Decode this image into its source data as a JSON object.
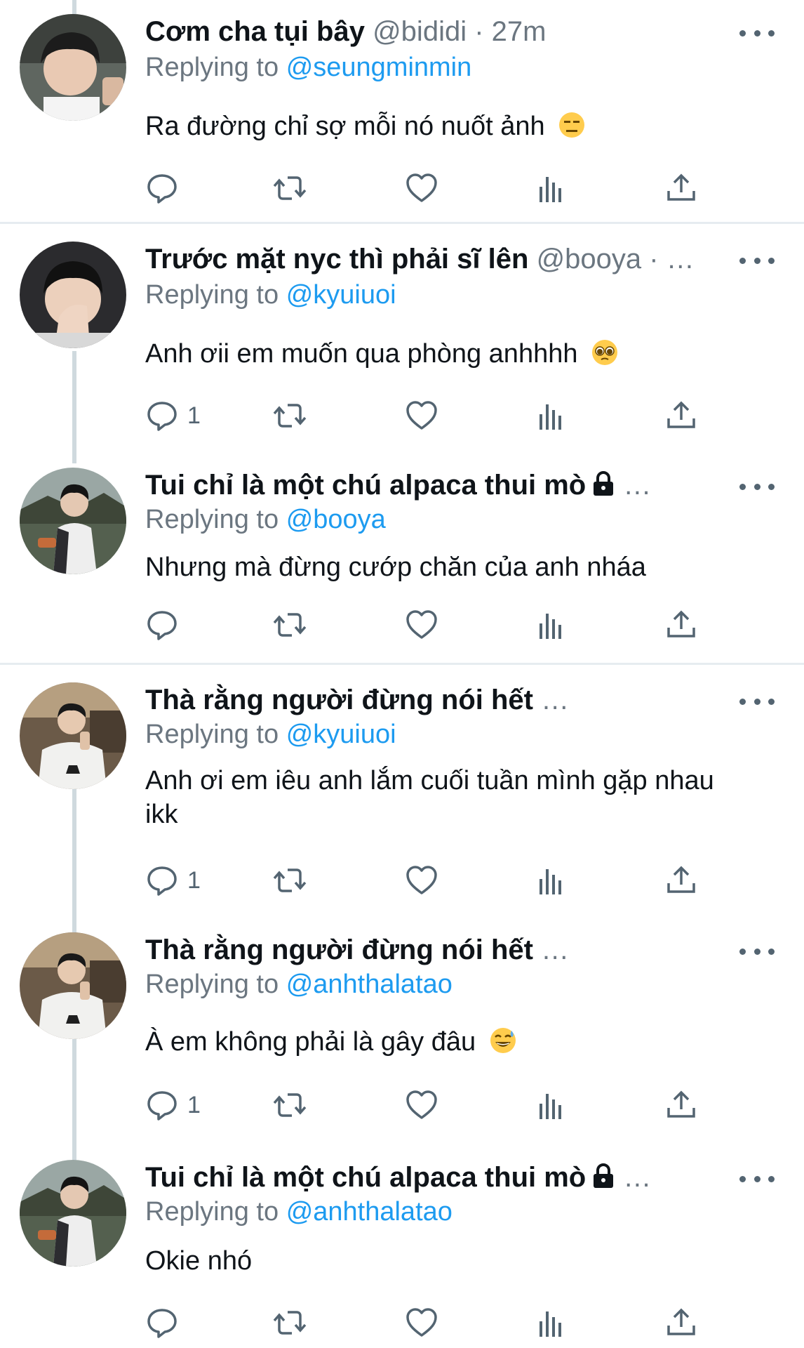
{
  "tweets": [
    {
      "name": "Cơm cha tụi bây",
      "handle": "@bididi",
      "time_sep": " · ",
      "time": "27m",
      "truncated": "",
      "locked": false,
      "reply_label": "Replying to",
      "reply_to": "@seungminmin",
      "text": "Ra đường chỉ sợ mỗi nó nuốt ảnh",
      "emoji": "expressionless-face",
      "reply_count": "",
      "avatar": "avatar-boy-glasses"
    },
    {
      "name": "Trước mặt nyc thì phải sĩ lên",
      "handle": "@booya",
      "time_sep": " · ",
      "time": "",
      "truncated": "…",
      "locked": false,
      "reply_label": "Replying to",
      "reply_to": "@kyuiuoi",
      "text": "Anh ơii em muốn qua phòng anhhhh",
      "emoji": "pleading-face",
      "reply_count": "1",
      "avatar": "avatar-boy-kiss"
    },
    {
      "name": "Tui chỉ là một chú alpaca thui mò",
      "handle": "",
      "time_sep": "",
      "time": "",
      "truncated": "…",
      "locked": true,
      "reply_label": "Replying to",
      "reply_to": "@booya",
      "text": "Nhưng mà đừng cướp chăn của anh nháa",
      "emoji": "",
      "reply_count": "",
      "avatar": "avatar-man-outdoor"
    },
    {
      "name": "Thà rằng người đừng nói hết",
      "handle": "",
      "time_sep": "",
      "time": "",
      "truncated": "…",
      "locked": false,
      "reply_label": "Replying to",
      "reply_to": "@kyuiuoi",
      "text": "Anh ơi em iêu anh lắm cuối tuần mình gặp nhau ikk",
      "emoji": "",
      "reply_count": "1",
      "avatar": "avatar-man-cafe"
    },
    {
      "name": "Thà rằng người đừng nói hết",
      "handle": "",
      "time_sep": "",
      "time": "",
      "truncated": "…",
      "locked": false,
      "reply_label": "Replying to",
      "reply_to": "@anhthalatao",
      "text": "À em không phải là gây đâu",
      "emoji": "grinning-sweat-face",
      "reply_count": "1",
      "avatar": "avatar-man-cafe"
    },
    {
      "name": "Tui chỉ là một chú alpaca thui mò",
      "handle": "",
      "time_sep": "",
      "time": "",
      "truncated": "…",
      "locked": true,
      "reply_label": "Replying to",
      "reply_to": "@anhthalatao",
      "text": "Okie nhó",
      "emoji": "",
      "reply_count": "",
      "avatar": "avatar-man-outdoor"
    }
  ],
  "colors": {
    "mention": "#1d9bf0",
    "secondary_text": "#6b7680",
    "icon": "#536471",
    "divider": "#e6ecf0",
    "thread_line": "#cfd9de"
  }
}
